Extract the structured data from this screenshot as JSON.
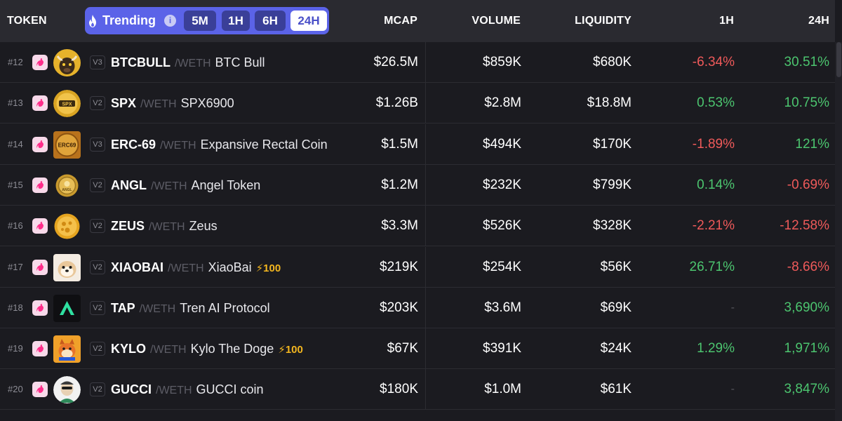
{
  "header": {
    "token": "TOKEN",
    "mcap": "MCAP",
    "volume": "VOLUME",
    "liquidity": "LIQUIDITY",
    "h1": "1H",
    "h24": "24H"
  },
  "filter": {
    "label": "Trending",
    "info": "i",
    "timeframes": [
      "5M",
      "1H",
      "6H",
      "24H"
    ],
    "selected": "24H"
  },
  "colors": {
    "positive": "#4cc56f",
    "negative": "#ef5a5a",
    "accent": "#5b63e8"
  },
  "rows": [
    {
      "rank": "#12",
      "version": "V3",
      "symbol": "BTCBULL",
      "pair": "/WETH",
      "name": "BTC Bull",
      "boost": "",
      "mcap": "$26.5M",
      "volume": "$859K",
      "liquidity": "$680K",
      "h1": "-6.34%",
      "h24": "30.51%"
    },
    {
      "rank": "#13",
      "version": "V2",
      "symbol": "SPX",
      "pair": "/WETH",
      "name": "SPX6900",
      "boost": "",
      "mcap": "$1.26B",
      "volume": "$2.8M",
      "liquidity": "$18.8M",
      "h1": "0.53%",
      "h24": "10.75%"
    },
    {
      "rank": "#14",
      "version": "V3",
      "symbol": "ERC-69",
      "pair": "/WETH",
      "name": "Expansive Rectal Coin",
      "boost": "",
      "mcap": "$1.5M",
      "volume": "$494K",
      "liquidity": "$170K",
      "h1": "-1.89%",
      "h24": "121%"
    },
    {
      "rank": "#15",
      "version": "V2",
      "symbol": "ANGL",
      "pair": "/WETH",
      "name": "Angel Token",
      "boost": "",
      "mcap": "$1.2M",
      "volume": "$232K",
      "liquidity": "$799K",
      "h1": "0.14%",
      "h24": "-0.69%"
    },
    {
      "rank": "#16",
      "version": "V2",
      "symbol": "ZEUS",
      "pair": "/WETH",
      "name": "Zeus",
      "boost": "",
      "mcap": "$3.3M",
      "volume": "$526K",
      "liquidity": "$328K",
      "h1": "-2.21%",
      "h24": "-12.58%"
    },
    {
      "rank": "#17",
      "version": "V2",
      "symbol": "XIAOBAI",
      "pair": "/WETH",
      "name": "XiaoBai",
      "boost": "⚡100",
      "mcap": "$219K",
      "volume": "$254K",
      "liquidity": "$56K",
      "h1": "26.71%",
      "h24": "-8.66%"
    },
    {
      "rank": "#18",
      "version": "V2",
      "symbol": "TAP",
      "pair": "/WETH",
      "name": "Tren AI Protocol",
      "boost": "",
      "mcap": "$203K",
      "volume": "$3.6M",
      "liquidity": "$69K",
      "h1": "-",
      "h24": "3,690%"
    },
    {
      "rank": "#19",
      "version": "V2",
      "symbol": "KYLO",
      "pair": "/WETH",
      "name": "Kylo The Doge",
      "boost": "⚡100",
      "mcap": "$67K",
      "volume": "$391K",
      "liquidity": "$24K",
      "h1": "1.29%",
      "h24": "1,971%"
    },
    {
      "rank": "#20",
      "version": "V2",
      "symbol": "GUCCI",
      "pair": "/WETH",
      "name": "GUCCI coin",
      "boost": "",
      "mcap": "$180K",
      "volume": "$1.0M",
      "liquidity": "$61K",
      "h1": "-",
      "h24": "3,847%"
    }
  ]
}
